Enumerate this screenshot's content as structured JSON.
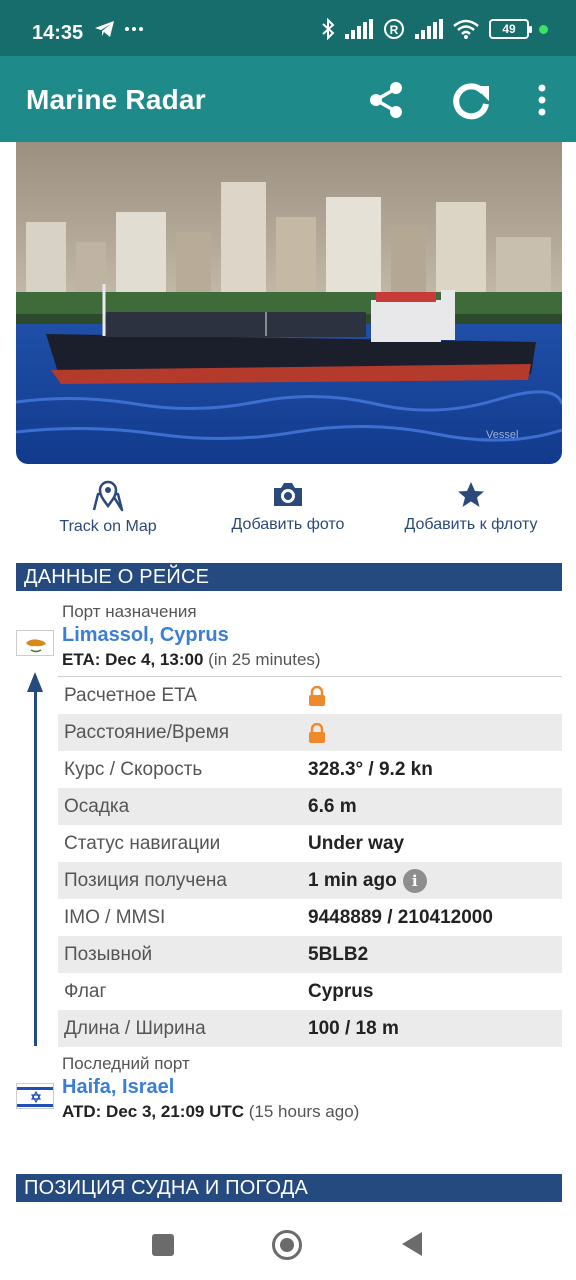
{
  "status_bar": {
    "time": "14:35",
    "left_icons": [
      "telegram-icon",
      "more-notifications-icon"
    ],
    "right_icons": [
      "bluetooth-icon",
      "signal-icon",
      "roaming-icon",
      "signal-icon",
      "wifi-icon",
      "battery-icon"
    ],
    "battery": "49"
  },
  "app_bar": {
    "title": "Marine Radar",
    "actions": [
      "share-icon",
      "refresh-icon",
      "more-vert-icon"
    ],
    "color": "#1e8a8a"
  },
  "actions": [
    {
      "label": "Track on Map",
      "icon": "map-pin-icon"
    },
    {
      "label": "Добавить фото",
      "icon": "camera-icon"
    },
    {
      "label": "Добавить к флоту",
      "icon": "star-icon"
    }
  ],
  "voyage": {
    "section_title": "ДАННЫЕ О РЕЙСЕ",
    "destination": {
      "sub": "Порт назначения",
      "name": "Limassol, Cyprus",
      "time_label": "ETA: Dec 4, 13:00",
      "time_rel": "(in 25 minutes)",
      "flag": "cyprus-flag-icon"
    },
    "rows": [
      {
        "label": "Расчетное ETA",
        "value": "",
        "locked": true
      },
      {
        "label": "Расстояние/Время",
        "value": "",
        "locked": true
      },
      {
        "label": "Курс / Скорость",
        "value": "328.3° / 9.2 kn"
      },
      {
        "label": "Осадка",
        "value": "6.6 m"
      },
      {
        "label": "Статус навигации",
        "value": "Under way"
      },
      {
        "label": "Позиция получена",
        "value": "1 min ago",
        "info": true
      },
      {
        "label": "IMO / MMSI",
        "value": "9448889 / 210412000"
      },
      {
        "label": "Позывной",
        "value": "5BLB2"
      },
      {
        "label": "Флаг",
        "value": "Cyprus"
      },
      {
        "label": "Длина / Ширина",
        "value": "100 / 18 m"
      }
    ],
    "last_port": {
      "sub": "Последний порт",
      "name": "Haifa, Israel",
      "time_label": "ATD: Dec 3, 21:09 UTC",
      "time_rel": "(15 hours ago)",
      "flag": "israel-flag-icon"
    }
  },
  "position_section": {
    "title": "ПОЗИЦИЯ СУДНА И ПОГОДА"
  },
  "colors": {
    "header_bg": "#244a7f",
    "link": "#3a7ed6",
    "lock": "#f0892b"
  }
}
